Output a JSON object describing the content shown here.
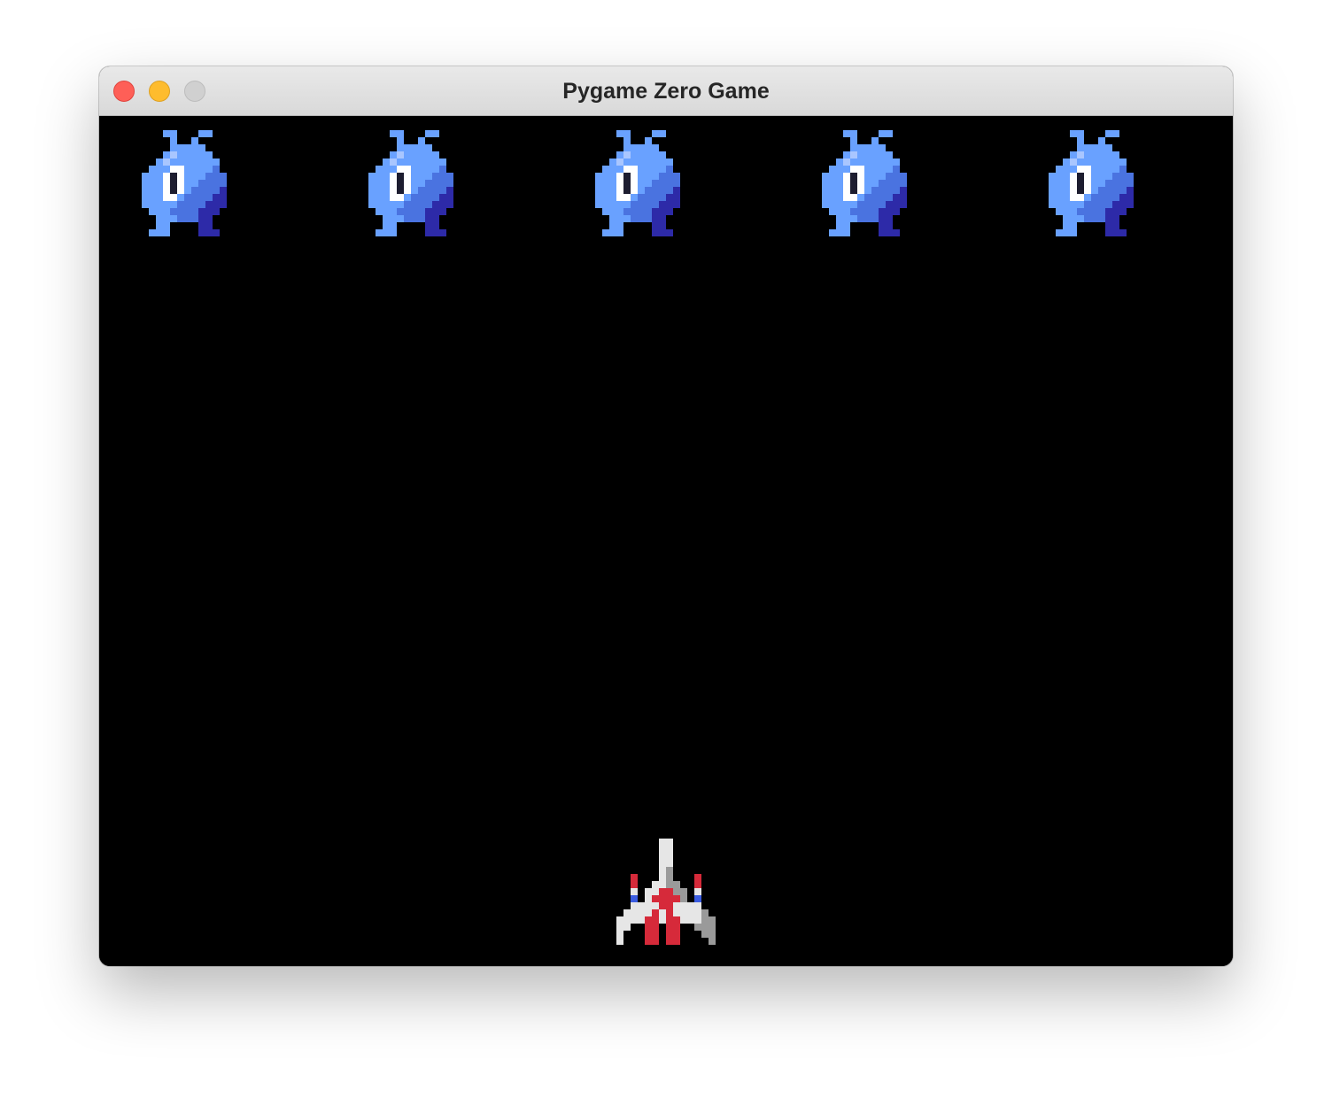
{
  "window": {
    "title": "Pygame Zero Game"
  },
  "window_controls": [
    "close",
    "minimize",
    "zoom"
  ],
  "colors": {
    "background": "#000000",
    "alien_light": "#69a1ff",
    "alien_mid": "#4a73e0",
    "alien_dark": "#2d2aa8",
    "alien_eye": "#1d1d30",
    "alien_highlight": "#ffffff",
    "ship_white": "#e6e6e6",
    "ship_grey": "#9a9a9a",
    "ship_red": "#d62a3a",
    "ship_blue": "#3a5ce0"
  },
  "game": {
    "aliens": [
      {
        "sprite": "alien-icon"
      },
      {
        "sprite": "alien-icon"
      },
      {
        "sprite": "alien-icon"
      },
      {
        "sprite": "alien-icon"
      },
      {
        "sprite": "alien-icon"
      }
    ],
    "player": {
      "sprite": "player-ship-icon"
    }
  }
}
